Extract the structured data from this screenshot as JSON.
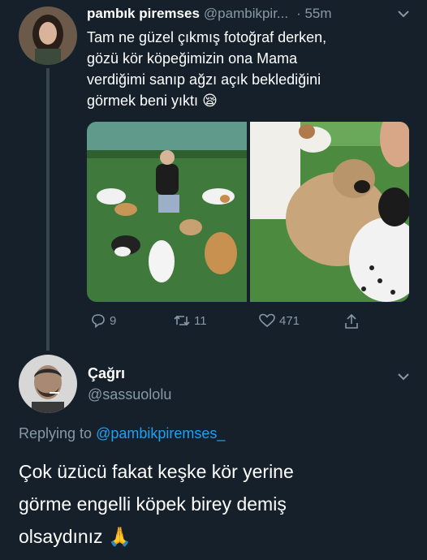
{
  "tweet": {
    "display_name": "pambık piremses",
    "handle": "@pambikpir...",
    "time": "· 55m",
    "text_lines": [
      "Tam ne güzel çıkmış fotoğraf derken,",
      "gözü kör köpeğimizin ona Mama",
      "verdiğimi sanıp ağzı açık beklediğini",
      "görmek beni yıktı"
    ],
    "emoji": "😪",
    "actions": {
      "replies": "9",
      "retweets": "11",
      "likes": "471"
    }
  },
  "reply": {
    "display_name": "Çağrı",
    "handle": "@sassuololu",
    "replying_prefix": "Replying to",
    "replying_handle": "@pambikpiremses_",
    "text_lines": [
      "Çok üzücü fakat keşke kör yerine",
      "görme engelli köpek birey demiş",
      "olsaydınız"
    ],
    "emoji": "🙏"
  },
  "icons": {
    "reply": "reply-icon",
    "retweet": "retweet-icon",
    "like": "heart-icon",
    "share": "share-icon",
    "menu": "chevron-down-icon"
  },
  "colors": {
    "background": "#15202b",
    "muted": "#8899a6",
    "link": "#1da1f2"
  }
}
